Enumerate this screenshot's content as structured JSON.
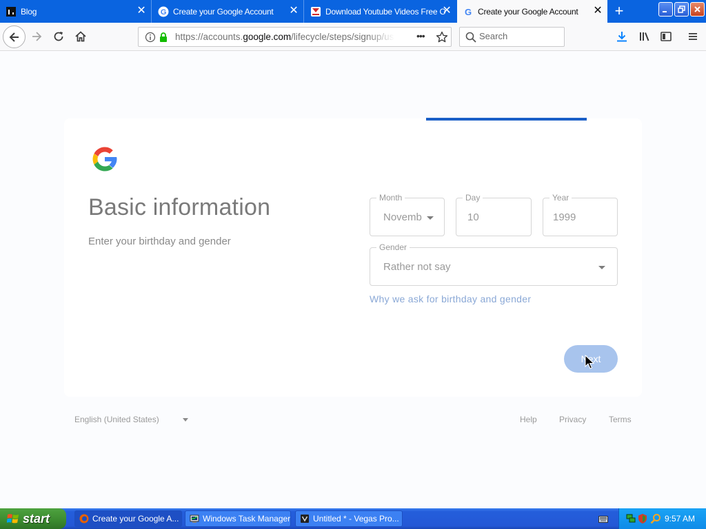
{
  "browser": {
    "tabs": [
      {
        "title": "Blog",
        "favicon": "blog-favicon",
        "close": "✕"
      },
      {
        "title": "Create your Google Account",
        "favicon": "google-favicon",
        "close": "✕"
      },
      {
        "title": "Download Youtube Videos Free O",
        "favicon": "download-favicon",
        "close": "✕"
      },
      {
        "title": "Create your Google Account",
        "favicon": "google-favicon",
        "close": "✕"
      }
    ],
    "new_tab": "+",
    "url_host_prefix": "https://accounts.",
    "url_host": "google.com",
    "url_path": "/lifecycle/steps/signup/us",
    "search_placeholder": "Search",
    "page_actions": "•••"
  },
  "page": {
    "heading": "Basic information",
    "subheading": "Enter your birthday and gender",
    "month": {
      "label": "Month",
      "value": "Novemb"
    },
    "day": {
      "label": "Day",
      "value": "10"
    },
    "year": {
      "label": "Year",
      "value": "1999"
    },
    "gender": {
      "label": "Gender",
      "value": "Rather not say"
    },
    "why_link": "Why we ask for birthday and gender",
    "next_button": "Next"
  },
  "footer": {
    "language": "English (United States)",
    "help": "Help",
    "privacy": "Privacy",
    "terms": "Terms"
  },
  "taskbar": {
    "start": "start",
    "tasks": [
      {
        "label": "Create your Google A..."
      },
      {
        "label": "Windows Task Manager"
      },
      {
        "label": "Untitled * - Vegas Pro..."
      }
    ],
    "clock": "9:57 AM"
  },
  "colors": {
    "titlebar": "#0a64e0",
    "progress": "#1a5fc7",
    "next_button": "#a8c4ed",
    "link": "#8aa8d6"
  }
}
